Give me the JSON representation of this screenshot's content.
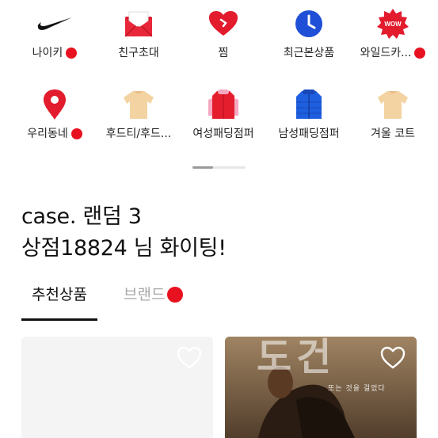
{
  "categories_row1": [
    {
      "label": "나이키",
      "icon": "nike-swoosh-icon",
      "dot": true
    },
    {
      "label": "친구초대",
      "icon": "invite-envelope-icon",
      "dot": false
    },
    {
      "label": "찜",
      "icon": "heart-icon",
      "dot": false
    },
    {
      "label": "최근본상품",
      "icon": "clock-icon",
      "dot": false
    },
    {
      "label": "와일드카...",
      "icon": "wow-badge-icon",
      "dot": true
    }
  ],
  "categories_row2": [
    {
      "label": "우리동네",
      "icon": "location-pin-icon",
      "dot": true
    },
    {
      "label": "후드티/후드...",
      "icon": "hoodie-icon",
      "dot": false
    },
    {
      "label": "여성패딩점퍼",
      "icon": "womens-padding-icon",
      "dot": false
    },
    {
      "label": "남성패딩점퍼",
      "icon": "mens-padding-icon",
      "dot": false
    },
    {
      "label": "겨울 코트",
      "icon": "coat-icon",
      "dot": false
    }
  ],
  "title": {
    "line1": "case. 랜덤 3",
    "line2": "상점18824 님 화이팅!"
  },
  "tabs": {
    "recommended": "추천상품",
    "brand": "브랜드"
  },
  "poster": {
    "title": "도건",
    "subtitle": "또는 것을 걸었다"
  },
  "colors": {
    "accent_red": "#e8111f",
    "clock_blue": "#1f4fd6",
    "tab_inactive": "#a8a8a8"
  }
}
